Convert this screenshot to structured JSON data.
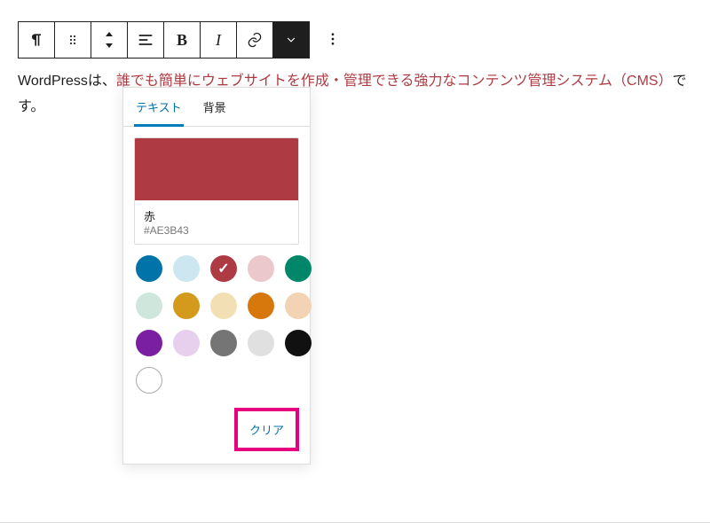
{
  "toolbar": {
    "paragraph_icon": "paragraph",
    "drag_icon": "drag-handle",
    "move_icon": "move-up-down",
    "align_icon": "align-left",
    "bold_label": "B",
    "italic_label": "I",
    "link_icon": "link",
    "dropdown_icon": "chevron-down",
    "more_icon": "more-vertical"
  },
  "content": {
    "prefix": "WordPressは、",
    "highlight": "誰でも簡単にウェブサイトを作成・管理できる強力なコンテンツ管理システム（CMS）",
    "suffix": "です。"
  },
  "popover": {
    "tabs": {
      "text": "テキスト",
      "background": "背景"
    },
    "preview": {
      "name": "赤",
      "hex": "#AE3B43"
    },
    "swatches": [
      {
        "name": "blue",
        "hex": "#0073A8"
      },
      {
        "name": "light-blue",
        "hex": "#CDE7F0"
      },
      {
        "name": "red",
        "hex": "#AE3B43",
        "selected": true
      },
      {
        "name": "pink",
        "hex": "#EBC8CB"
      },
      {
        "name": "green",
        "hex": "#00876A"
      },
      {
        "name": "mint",
        "hex": "#CFE6DC"
      },
      {
        "name": "gold",
        "hex": "#D39A1B"
      },
      {
        "name": "cream",
        "hex": "#F3DFB4"
      },
      {
        "name": "orange",
        "hex": "#D6780C"
      },
      {
        "name": "peach",
        "hex": "#F2D4B4"
      },
      {
        "name": "purple",
        "hex": "#7B1FA2"
      },
      {
        "name": "lavender",
        "hex": "#E7CFEE"
      },
      {
        "name": "gray",
        "hex": "#757575"
      },
      {
        "name": "light-gray",
        "hex": "#E0E0E0"
      },
      {
        "name": "black",
        "hex": "#111111"
      },
      {
        "name": "white",
        "hex": "#FFFFFF",
        "ring": true
      }
    ],
    "clear_label": "クリア"
  },
  "colors": {
    "accent": "#007cba",
    "highlight_border": "#e6007e",
    "text_highlight": "#AE3B43"
  }
}
